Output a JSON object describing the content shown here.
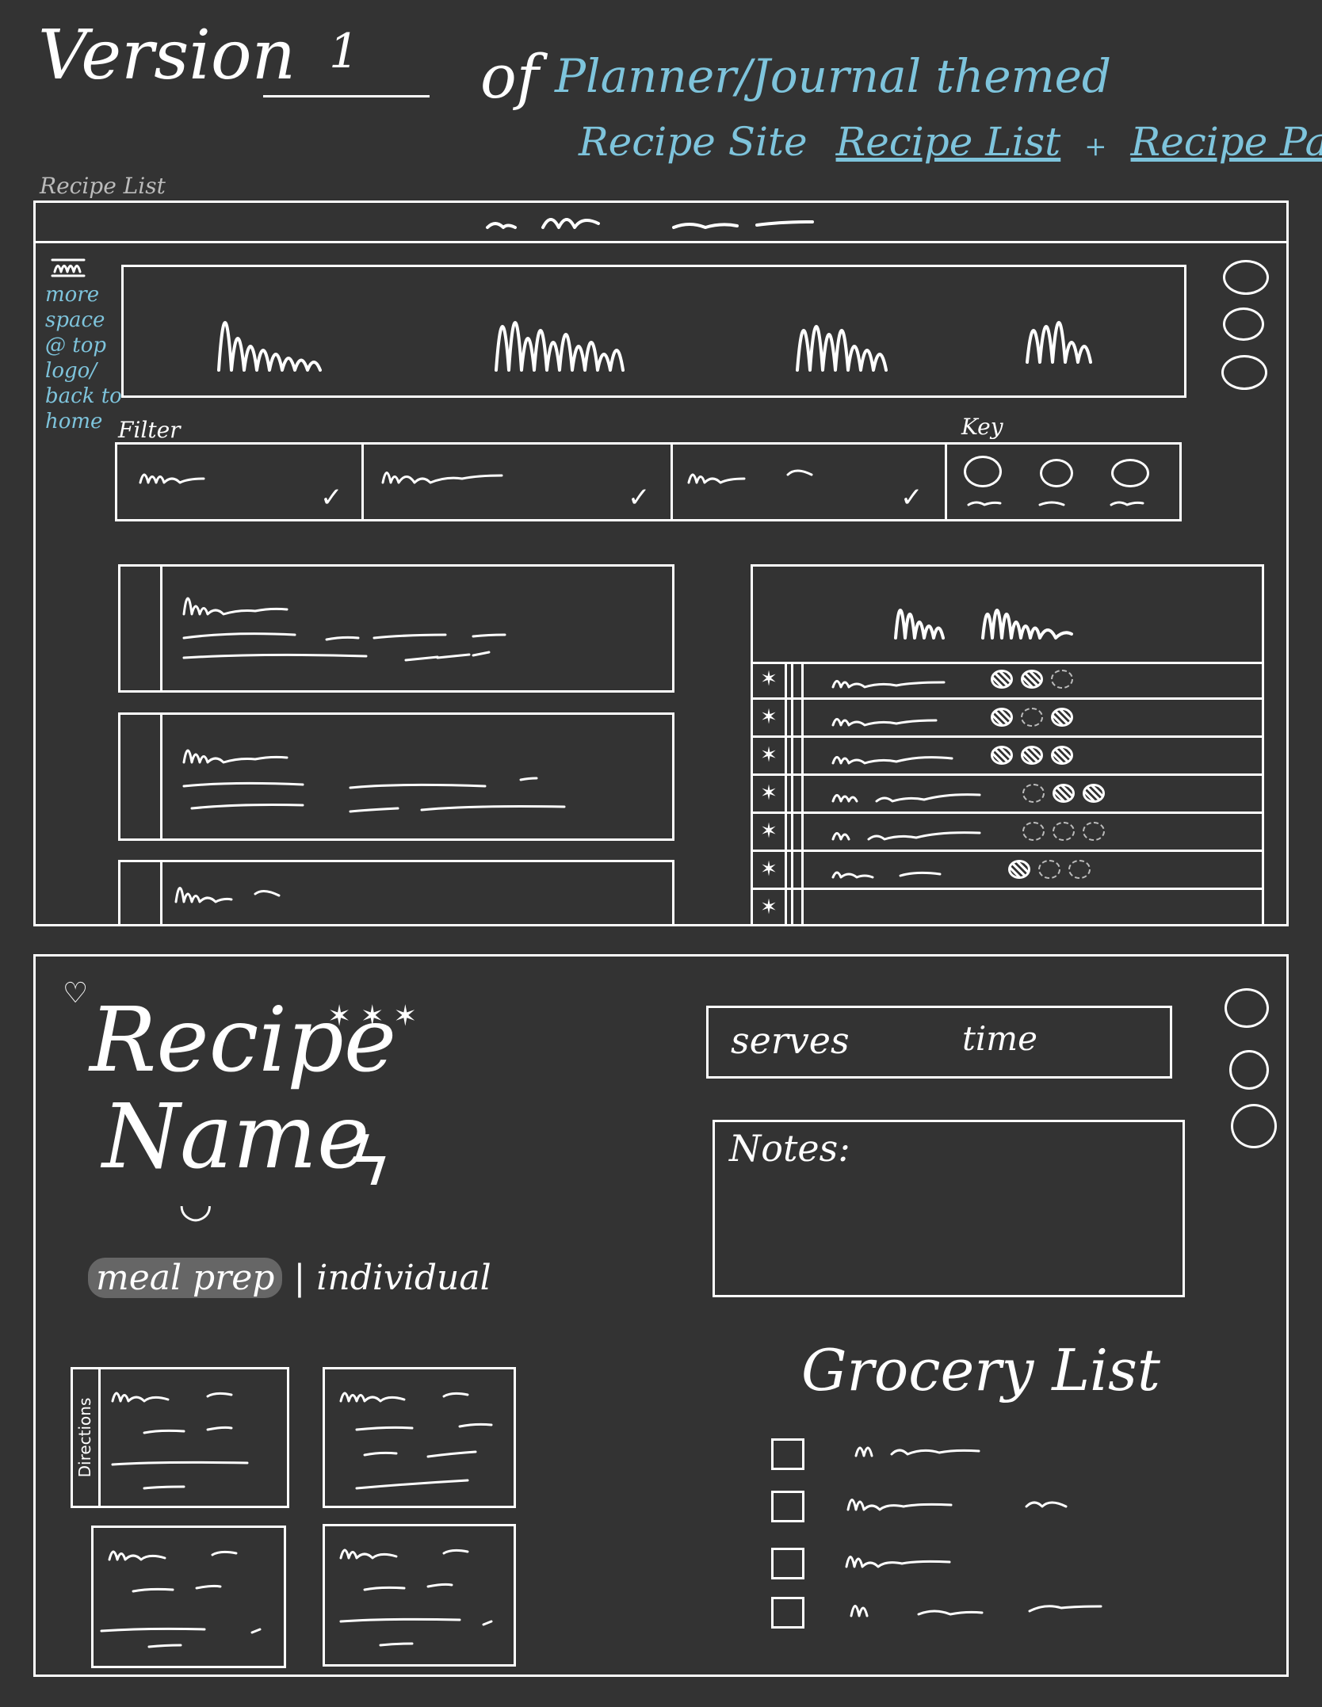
{
  "header": {
    "version_label": "Version",
    "version_number": "1",
    "of_label": "of",
    "theme_line1": "Planner/Journal themed",
    "theme_line2": "Recipe Site",
    "link_recipe_list": "Recipe List",
    "plus": "+",
    "link_recipe_page": "Recipe Page"
  },
  "recipe_list": {
    "caption": "Recipe List",
    "annotation": {
      "line1": "more space",
      "line2": "@ top",
      "line3": "logo/",
      "line4": "back to",
      "line5": "home"
    },
    "filter_label": "Filter",
    "key_label": "Key",
    "table_rows": [
      {
        "star": "✶",
        "dots": [
          "filled",
          "filled",
          "empty"
        ]
      },
      {
        "star": "✶",
        "dots": [
          "filled",
          "empty",
          "filled"
        ]
      },
      {
        "star": "✶",
        "dots": [
          "filled",
          "filled",
          "filled"
        ]
      },
      {
        "star": "✶",
        "dots": [
          "empty",
          "filled",
          "filled"
        ]
      },
      {
        "star": "✶",
        "dots": [
          "empty",
          "empty",
          "empty"
        ]
      },
      {
        "star": "✶",
        "dots": [
          "filled",
          "empty",
          "empty"
        ]
      }
    ],
    "check_mark": "✓"
  },
  "recipe_page": {
    "title_line1": "Recipe",
    "title_line2": "Name",
    "heart": "♡",
    "stars": "✶ ✶ ✶",
    "bolt": "ϟ",
    "smile": "◡",
    "tag_meal_prep": "meal prep",
    "separator": "|",
    "tag_individual": "individual",
    "serves_label": "serves",
    "time_label": "time",
    "notes_label": "Notes:",
    "directions_label": "Directions",
    "grocery_title": "Grocery List"
  }
}
